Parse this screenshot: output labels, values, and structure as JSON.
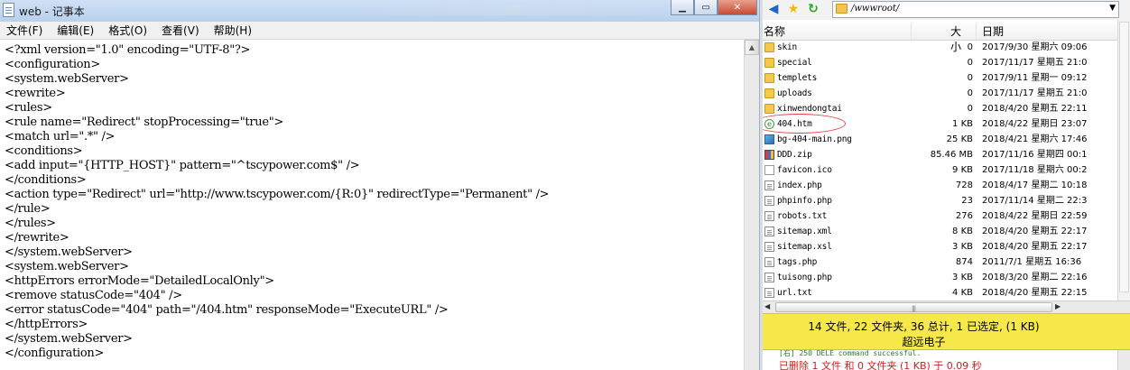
{
  "notepad": {
    "title": "web - 记事本",
    "menu": [
      "文件(F)",
      "编辑(E)",
      "格式(O)",
      "查看(V)",
      "帮助(H)"
    ],
    "content_lines": [
      "<?xml version=\"1.0\" encoding=\"UTF-8\"?>",
      "<configuration>",
      "<system.webServer>",
      "<rewrite>",
      "<rules>",
      "<rule name=\"Redirect\" stopProcessing=\"true\">",
      "<match url=\".*\" />",
      "<conditions>",
      "<add input=\"{HTTP_HOST}\" pattern=\"^tscypower.com$\" />",
      "</conditions>",
      "<action type=\"Redirect\" url=\"http://www.tscypower.com/{R:0}\" redirectType=\"Permanent\" />",
      "</rule>",
      "</rules>",
      "</rewrite>",
      "</system.webServer>",
      "<system.webServer>",
      "<httpErrors errorMode=\"DetailedLocalOnly\">",
      "<remove statusCode=\"404\" />",
      "<error statusCode=\"404\" path=\"/404.htm\" responseMode=\"ExecuteURL\" />",
      "</httpErrors>",
      "</system.webServer>",
      "</configuration>"
    ]
  },
  "file_pane": {
    "path": "/wwwroot/",
    "columns": {
      "name": "名称",
      "size": "大小",
      "date": "日期"
    },
    "files": [
      {
        "name": "skin",
        "size": "0",
        "date": "2017/9/30 星期六 09:06",
        "type": "folder"
      },
      {
        "name": "special",
        "size": "0",
        "date": "2017/11/17 星期五 21:0",
        "type": "folder"
      },
      {
        "name": "templets",
        "size": "0",
        "date": "2017/9/11 星期一 09:12",
        "type": "folder"
      },
      {
        "name": "uploads",
        "size": "0",
        "date": "2017/11/17 星期五 21:0",
        "type": "folder"
      },
      {
        "name": "xinwendongtai",
        "size": "0",
        "date": "2018/4/20 星期五 22:11",
        "type": "folder"
      },
      {
        "name": "404.htm",
        "size": "1 KB",
        "date": "2018/4/22 星期日 23:07",
        "type": "htm"
      },
      {
        "name": "bg-404-main.png",
        "size": "25 KB",
        "date": "2018/4/21 星期六 17:46",
        "type": "png"
      },
      {
        "name": "DDD.zip",
        "size": "85.46 MB",
        "date": "2017/11/16 星期四 00:1",
        "type": "zip"
      },
      {
        "name": "favicon.ico",
        "size": "9 KB",
        "date": "2017/11/18 星期六 00:2",
        "type": "ico"
      },
      {
        "name": "index.php",
        "size": "728",
        "date": "2018/4/17 星期二 10:18",
        "type": "doc"
      },
      {
        "name": "phpinfo.php",
        "size": "23",
        "date": "2017/11/14 星期二 22:3",
        "type": "doc"
      },
      {
        "name": "robots.txt",
        "size": "276",
        "date": "2018/4/22 星期日 22:59",
        "type": "doc"
      },
      {
        "name": "sitemap.xml",
        "size": "8 KB",
        "date": "2018/4/20 星期五 22:17",
        "type": "doc"
      },
      {
        "name": "sitemap.xsl",
        "size": "3 KB",
        "date": "2018/4/20 星期五 22:17",
        "type": "doc"
      },
      {
        "name": "tags.php",
        "size": "874",
        "date": "2011/7/1 星期五 16:36",
        "type": "doc"
      },
      {
        "name": "tuisong.php",
        "size": "3 KB",
        "date": "2018/3/20 星期二 22:16",
        "type": "doc"
      },
      {
        "name": "url.txt",
        "size": "4 KB",
        "date": "2018/4/20 星期五 22:15",
        "type": "doc"
      }
    ],
    "status_line1": "14 文件, 22 文件夹, 36 总计, 1 已选定, (1 KB)",
    "status_line2": "超远电子",
    "log_line1": "[右] 250 DELE command successful.",
    "log_line2": "已删除 1 文件 和 0 文件夹 (1 KB) 于 0.09 秒",
    "status_color": "#f6e74a",
    "highlight_color": "#e0424a"
  }
}
